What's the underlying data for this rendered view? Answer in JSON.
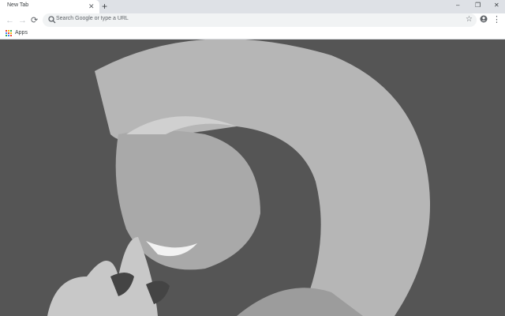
{
  "tabs": [
    {
      "title": "New Tab"
    }
  ],
  "window_controls": {
    "minimize": "–",
    "restore": "❐",
    "close": "✕"
  },
  "toolbar": {
    "back": "←",
    "forward": "→",
    "reload": "⟳",
    "placeholder": "Search Google or type a URL",
    "bookmark_star": "☆",
    "menu": "⋮"
  },
  "bookmarks": {
    "apps_label": "Apps"
  },
  "background": {
    "description_icon": "photo"
  },
  "icons": [
    "search-icon",
    "star-icon",
    "profile-icon",
    "menu-icon",
    "apps-grid-icon",
    "close-icon",
    "plus-icon"
  ]
}
